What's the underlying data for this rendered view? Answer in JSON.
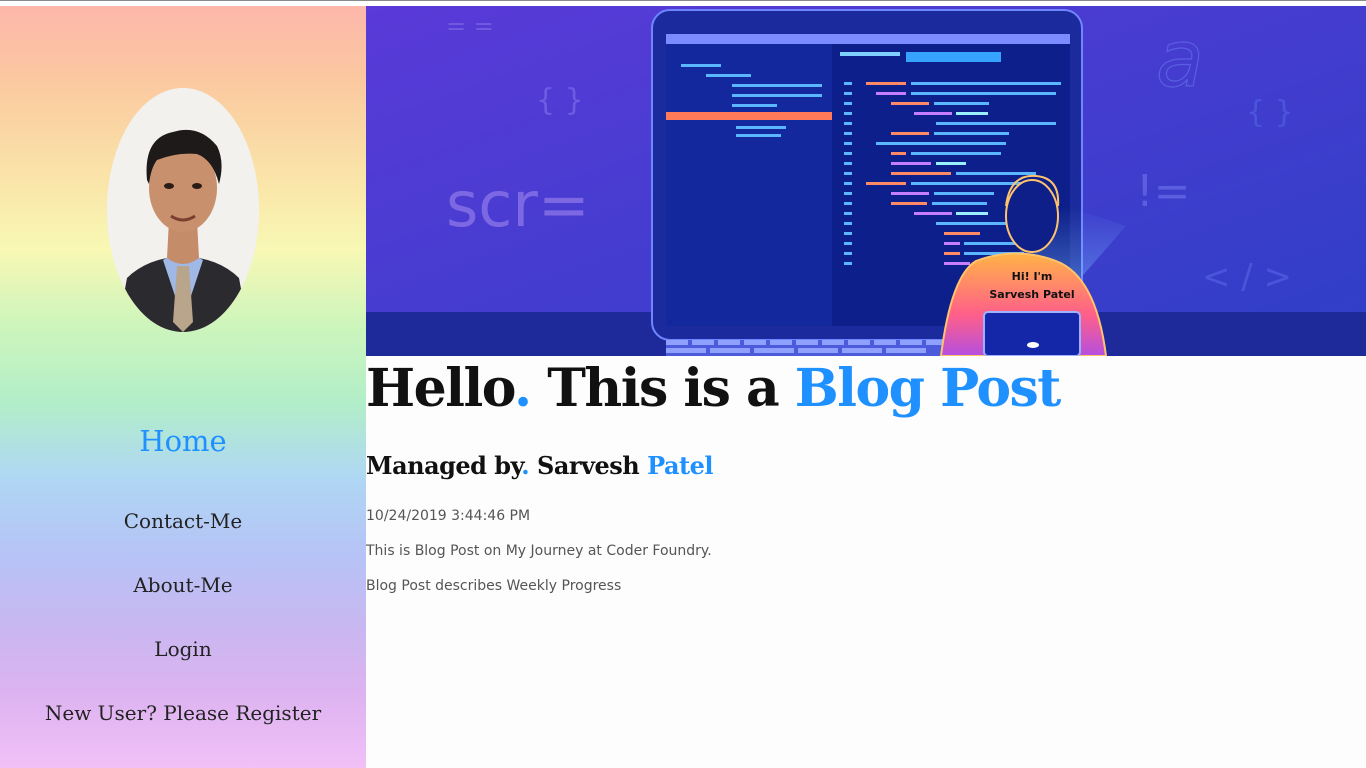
{
  "sidebar": {
    "avatar_alt": "Profile photo",
    "nav": {
      "home": "Home",
      "contact": "Contact-Me",
      "about": "About-Me",
      "login": "Login",
      "register": "New User? Please Register"
    }
  },
  "banner": {
    "code_text": "scr=",
    "braces_left": "{ }",
    "braces_right": "{ }",
    "not_equal": "!=",
    "double_equal": "= =",
    "tag_symbol": "< / >",
    "letter": "a",
    "shirt_line1": "Hi! I'm",
    "shirt_line2": "Sarvesh Patel"
  },
  "post": {
    "title_part1": "Hello",
    "title_dot": ".",
    "title_part2": " This is a ",
    "title_accent": "Blog Post",
    "managed_prefix": "Managed by",
    "managed_dot": ".",
    "managed_first": " Sarvesh ",
    "managed_last": "Patel",
    "date": "10/24/2019 3:44:46 PM",
    "line1": "This is Blog Post on My Journey at Coder Foundry.",
    "line2": "Blog Post describes Weekly Progress"
  },
  "colors": {
    "accent": "#1e90ff",
    "banner_bg": "#4a3fd0"
  }
}
